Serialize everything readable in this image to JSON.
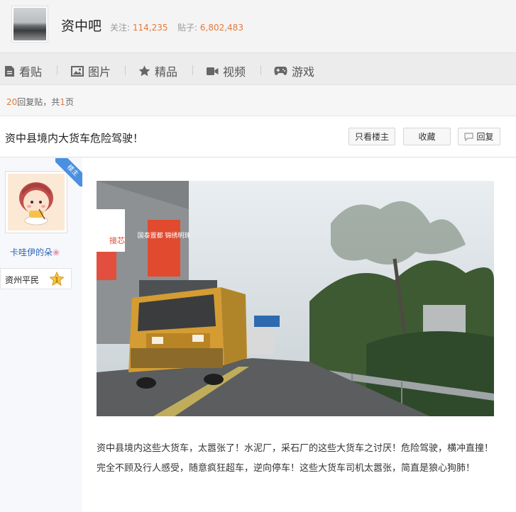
{
  "forum": {
    "name": "资中吧",
    "follow_label": "关注:",
    "follow_count": "114,235",
    "posts_label": "贴子:",
    "posts_count": "6,802,483"
  },
  "nav": {
    "items": [
      {
        "label": "看贴",
        "icon": "document-icon"
      },
      {
        "label": "图片",
        "icon": "image-icon"
      },
      {
        "label": "精品",
        "icon": "star-icon"
      },
      {
        "label": "视频",
        "icon": "video-icon"
      },
      {
        "label": "游戏",
        "icon": "gamepad-icon"
      }
    ]
  },
  "reply_info": {
    "count": "20",
    "text1": "回复贴，共",
    "pages": "1",
    "text2": "页"
  },
  "post": {
    "title": "资中县境内大货车危险驾驶！",
    "only_op_label": "只看楼主",
    "favorite_label": "收藏",
    "reply_label": "回复",
    "body": "资中县境内这些大货车，太嚣张了！水泥厂，采石厂的这些大货车之讨厌！危险驾驶，横冲直撞！完全不顾及行人感受，随意疯狂超车，逆向停车！这些大货车司机太嚣张，简直是狼心狗肺！"
  },
  "author": {
    "badge": "楼主",
    "name": "卡哇伊的朵",
    "level_name": "资州平民",
    "level": "1"
  },
  "image_text": {
    "building_sign": "国泰置都 锦绣明珠",
    "shop_sign": "接芯"
  },
  "colors": {
    "accent": "#e57a3c",
    "link": "#2d64b3",
    "badge": "#4a8fe0"
  }
}
